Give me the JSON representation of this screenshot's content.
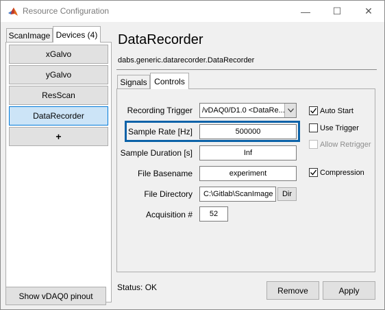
{
  "window": {
    "title": "Resource Configuration",
    "controls": {
      "minimize": "—",
      "maximize": "☐",
      "close": "✕"
    }
  },
  "left_tabs": [
    {
      "label": "ScanImage",
      "active": false
    },
    {
      "label": "Devices (4)",
      "active": true
    }
  ],
  "devices": [
    {
      "label": "xGalvo",
      "selected": false
    },
    {
      "label": "yGalvo",
      "selected": false
    },
    {
      "label": "ResScan",
      "selected": false
    },
    {
      "label": "DataRecorder",
      "selected": true
    },
    {
      "label": "+",
      "selected": false
    }
  ],
  "pinout_button": "Show vDAQ0 pinout",
  "device": {
    "title": "DataRecorder",
    "class_name": "dabs.generic.datarecorder.DataRecorder"
  },
  "inner_tabs": [
    {
      "label": "Signals",
      "active": false
    },
    {
      "label": "Controls",
      "active": true
    }
  ],
  "controls": {
    "recording_trigger": {
      "label": "Recording Trigger",
      "value": "/vDAQ0/D1.0 <DataRe..."
    },
    "sample_rate": {
      "label": "Sample Rate [Hz]",
      "value": "500000"
    },
    "sample_duration": {
      "label": "Sample Duration [s]",
      "value": "Inf"
    },
    "file_basename": {
      "label": "File Basename",
      "value": "experiment"
    },
    "file_directory": {
      "label": "File Directory",
      "value": "C:\\Gitlab\\ScanImage",
      "button": "Dir"
    },
    "acquisition": {
      "label": "Acquisition #",
      "value": "52"
    }
  },
  "checkboxes": {
    "auto_start": {
      "label": "Auto Start",
      "checked": true,
      "enabled": true
    },
    "use_trigger": {
      "label": "Use Trigger",
      "checked": false,
      "enabled": true
    },
    "allow_retrigger": {
      "label": "Allow Retrigger",
      "checked": false,
      "enabled": false
    },
    "compression": {
      "label": "Compression",
      "checked": true,
      "enabled": true
    }
  },
  "status_text": "Status: OK",
  "buttons": {
    "remove": "Remove",
    "apply": "Apply"
  },
  "colors": {
    "selection_fill": "#cce4f7",
    "selection_border": "#0078d7",
    "focus_highlight": "#0b62a8"
  }
}
